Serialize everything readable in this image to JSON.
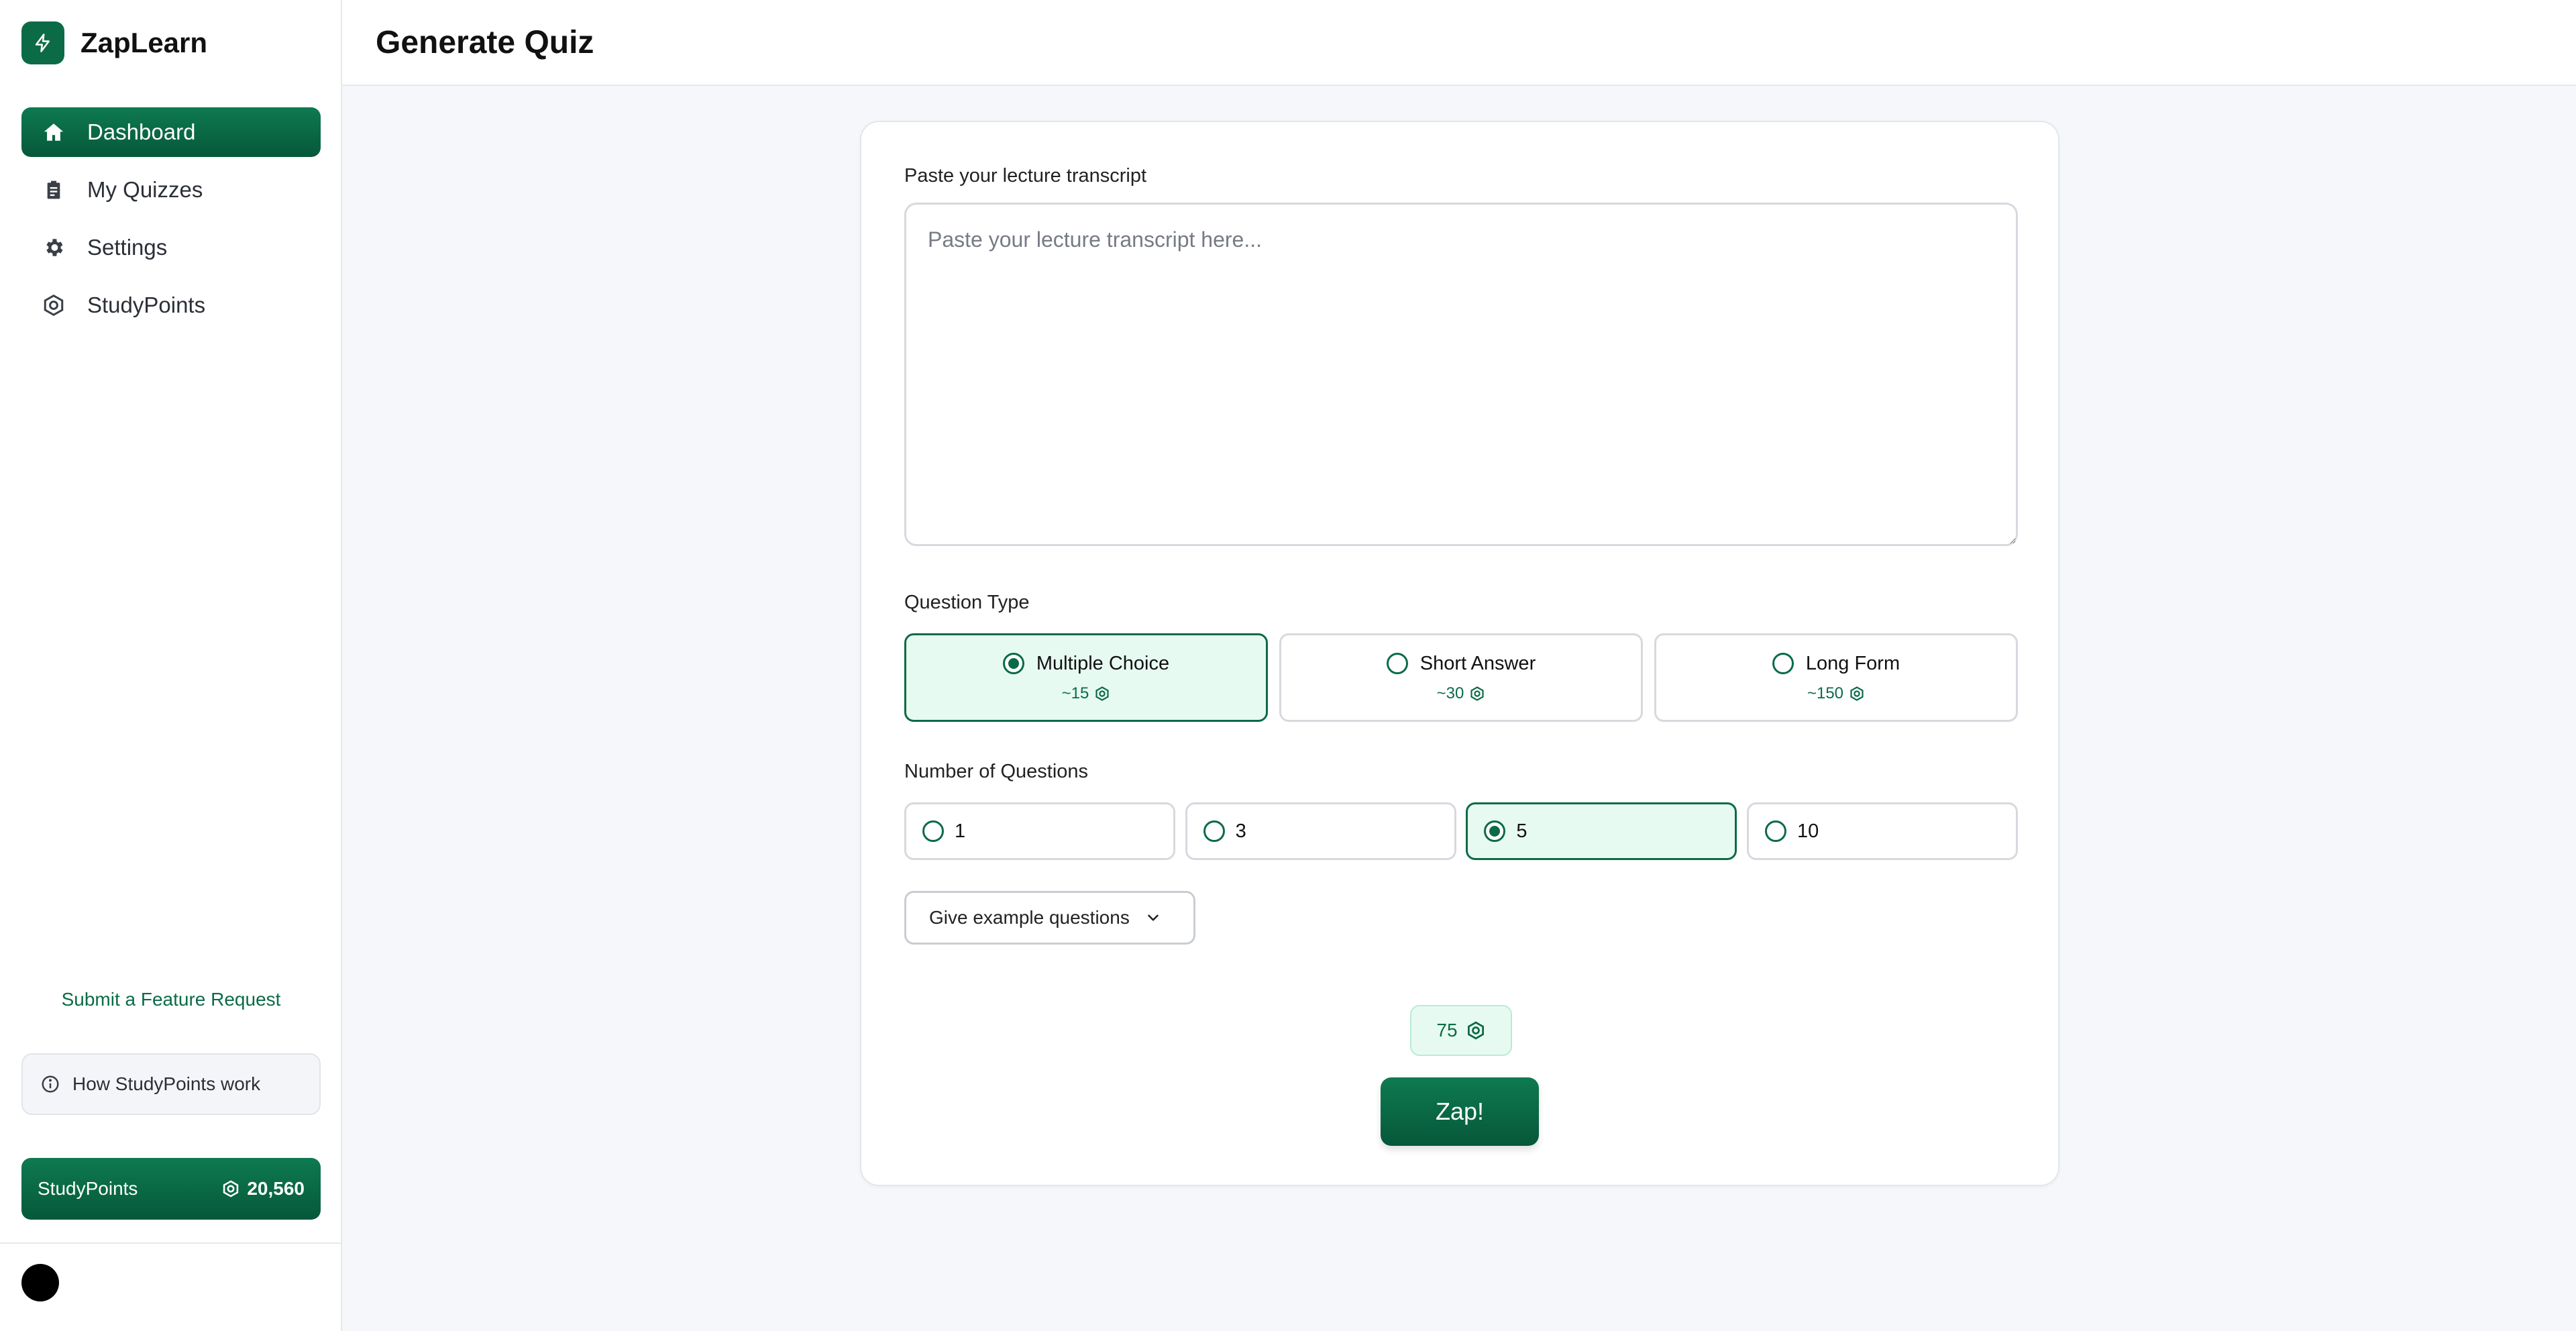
{
  "app": {
    "name": "ZapLearn",
    "logo_icon": "bolt-icon",
    "accent_color": "#0b6b47"
  },
  "sidebar": {
    "items": [
      {
        "label": "Dashboard",
        "icon": "home-icon",
        "active": true
      },
      {
        "label": "My Quizzes",
        "icon": "clipboard-icon",
        "active": false
      },
      {
        "label": "Settings",
        "icon": "gear-icon",
        "active": false
      },
      {
        "label": "StudyPoints",
        "icon": "hexagon-coin-icon",
        "active": false
      }
    ],
    "feature_request": "Submit a Feature Request",
    "how_points": "How StudyPoints work",
    "points_card": {
      "label": "StudyPoints",
      "value": "20,560"
    }
  },
  "header": {
    "title": "Generate Quiz"
  },
  "form": {
    "transcript_label": "Paste your lecture transcript",
    "transcript_placeholder": "Paste your lecture transcript here...",
    "transcript_value": "",
    "question_type_label": "Question Type",
    "question_types": [
      {
        "label": "Multiple Choice",
        "cost": "~15",
        "selected": true
      },
      {
        "label": "Short Answer",
        "cost": "~30",
        "selected": false
      },
      {
        "label": "Long Form",
        "cost": "~150",
        "selected": false
      }
    ],
    "num_questions_label": "Number of Questions",
    "num_options": [
      {
        "label": "1",
        "selected": false
      },
      {
        "label": "3",
        "selected": false
      },
      {
        "label": "5",
        "selected": true
      },
      {
        "label": "10",
        "selected": false
      }
    ],
    "examples_button": "Give example questions",
    "total_cost": "75",
    "submit_label": "Zap!"
  }
}
